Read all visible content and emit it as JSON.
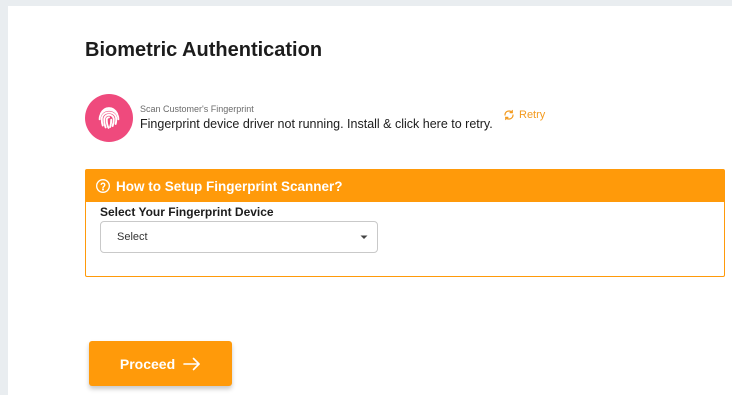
{
  "page": {
    "title": "Biometric Authentication"
  },
  "fingerprint": {
    "label": "Scan Customer's Fingerprint",
    "message": "Fingerprint device driver not running. Install & click here to retry.",
    "retry_label": "Retry",
    "icon": "fingerprint-icon",
    "icon_bg_color": "#ef4a7d"
  },
  "setup": {
    "header": "How to Setup Fingerprint Scanner?",
    "device_label": "Select Your Fingerprint Device",
    "select_value": "Select"
  },
  "actions": {
    "proceed_label": "Proceed"
  },
  "colors": {
    "accent": "#ff9a0a",
    "retry": "#f39a1e"
  }
}
